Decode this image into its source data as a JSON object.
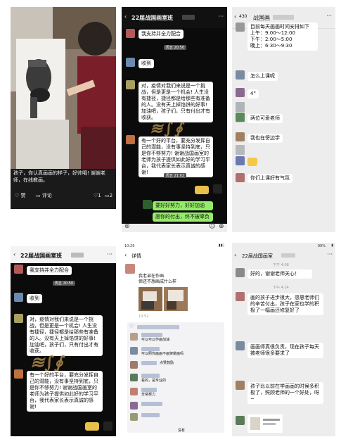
{
  "panel1": {
    "caption": "孩子，你认真画画的样子，好帅哦! 谢谢老师，在线教画。",
    "like_label": "赞",
    "comment_label": "评论",
    "like_count": "1",
    "comment_count": "2"
  },
  "panel2": {
    "title": "22届战国画室班",
    "messages": {
      "m1": "我支持并全力配合",
      "t1": "周五 20:50",
      "m2": "收到",
      "m3": "对，疫情对我们来说是一个挑战，但是更是一个机会! 人生没有捷径，捷径都是给那些有准备的人。没有天上掉馅饼的好事! 加油吧，孩子们，只有付出才有收获。",
      "m4": "有一个好的平台，要充分发挥自己的潜能，没有事坚持到底，只是你不够努力! 谢谢战国画室的老师为孩子提供如此好的学习平台，我代表家长表示真诚的感谢!",
      "t2": "周五 21:02",
      "m5": "要好好努力，好好加油",
      "m6": "愿你的付出，终不被辜负"
    }
  },
  "panel3": {
    "back_count": "430",
    "title": "战国画",
    "schedule": "目前每天画画时间安排如下\n上午：9:00～12:00\n下午：2:00～5:00\n晚上：6:30～9:30",
    "m1": "怎么上课呢",
    "m2": "4°",
    "m3": "两位可爱老师",
    "m4": "我也在傍边学",
    "m5": "你们上课好有气氛"
  },
  "panel4": {
    "title": "22届战国画室班",
    "messages": {
      "m1": "我支持并全力配合",
      "t1": "周五 20:50",
      "m2": "收到",
      "m3": "对，疫情对我们来说是一个挑战，但是更是一个机会! 人生没有捷径，捷径都是给那些有准备的人。没有天上掉馅饼的好事! 加油吧，孩子们，只有付出才有收获。",
      "m4": "有一个好的平台，要充分发挥自己的潜能，没有事坚持到底，只是你不够努力! 谢谢战国画室的老师为孩子提供如此好的学习平台，我代表家长表示真诚的感谢!"
    }
  },
  "panel5": {
    "status_time": "10:29",
    "title": "详情",
    "post_text": "我老弟在作画\n但还不想画成什么样",
    "post_time": "10:52",
    "c1": "可以可以作画加油",
    "c2": "可以照你画画不画架做画吗",
    "c3": "点赞鼓励",
    "c4": "看的，是专业的",
    "c5": "非常努力",
    "c6": "没有"
  },
  "panel6": {
    "title": "22届战国画室",
    "status_right": "99%",
    "t1": "下午 4:08",
    "m1": "好的，谢谢老师关心！",
    "t2": "下午 4:24",
    "m2": "画的孩子进步很大，感恩老师们的辛苦付出，孩子在家也学的积极了一幅画还修复好了",
    "m3": "画画师真很负责，现在孩子每天被老师很多要求了",
    "m4": "孩子比以前在学画画的时候多积极了，照顾老师的一个好处，呀~"
  }
}
